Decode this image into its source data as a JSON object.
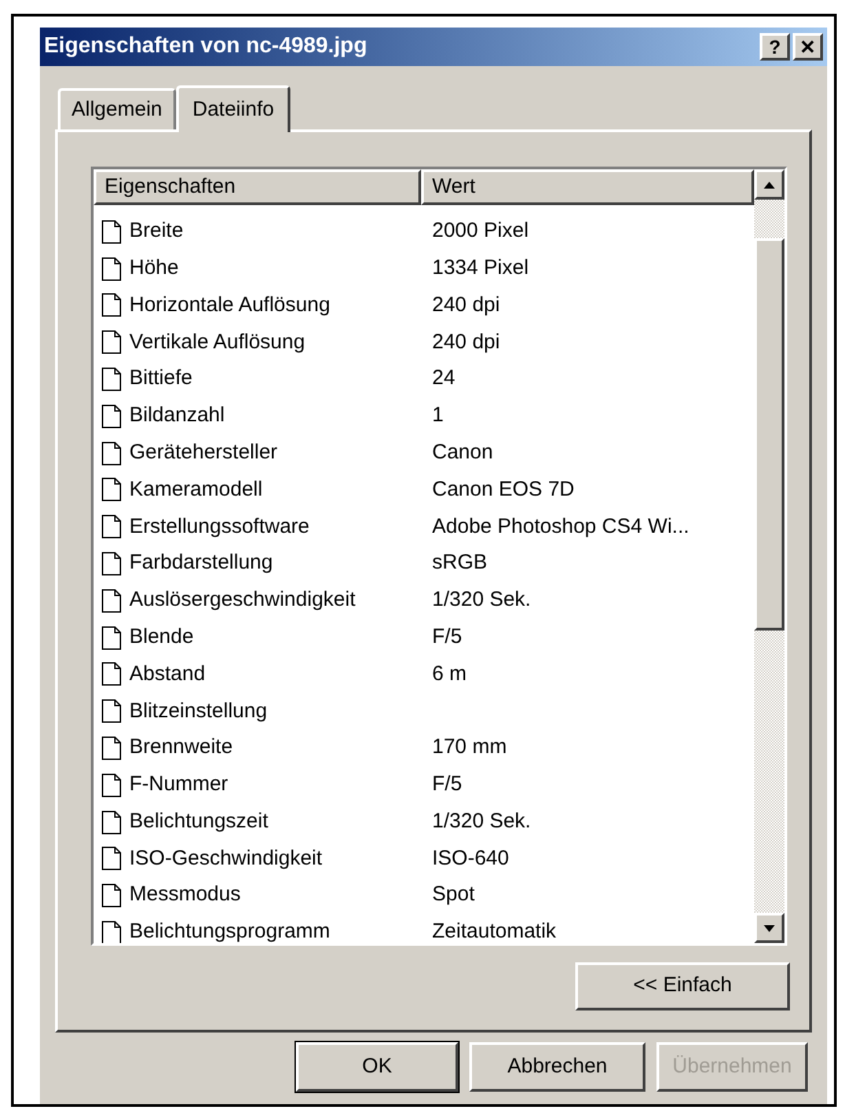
{
  "window": {
    "title": "Eigenschaften von nc-4989.jpg",
    "title_buttons": [
      "?",
      "✕"
    ]
  },
  "tabs": [
    {
      "label": "Allgemein",
      "selected": false
    },
    {
      "label": "Dateiinfo",
      "selected": true
    }
  ],
  "list": {
    "columns": [
      "Eigenschaften",
      "Wert"
    ],
    "rows": [
      {
        "name": "Breite",
        "value": "2000 Pixel"
      },
      {
        "name": "Höhe",
        "value": "1334 Pixel"
      },
      {
        "name": "Horizontale Auflösung",
        "value": "240 dpi"
      },
      {
        "name": "Vertikale Auflösung",
        "value": "240 dpi"
      },
      {
        "name": "Bittiefe",
        "value": "24"
      },
      {
        "name": "Bildanzahl",
        "value": "1"
      },
      {
        "name": "Gerätehersteller",
        "value": "Canon"
      },
      {
        "name": "Kameramodell",
        "value": "Canon EOS 7D"
      },
      {
        "name": "Erstellungssoftware",
        "value": "Adobe Photoshop CS4 Wi..."
      },
      {
        "name": "Farbdarstellung",
        "value": "sRGB"
      },
      {
        "name": "Auslösergeschwindigkeit",
        "value": "1/320 Sek."
      },
      {
        "name": "Blende",
        "value": "F/5"
      },
      {
        "name": "Abstand",
        "value": "6 m"
      },
      {
        "name": "Blitzeinstellung"
      },
      {
        "name": "Brennweite",
        "value": "170 mm"
      },
      {
        "name": "F-Nummer",
        "value": "F/5"
      },
      {
        "name": "Belichtungszeit",
        "value": "1/320 Sek."
      },
      {
        "name": "ISO-Geschwindigkeit",
        "value": "ISO-640"
      },
      {
        "name": "Messmodus",
        "value": "Spot"
      },
      {
        "name": "Belichtungsprogramm",
        "value": "Zeitautomatik"
      }
    ]
  },
  "toggle_button": "<< Einfach",
  "buttons": [
    {
      "label": "OK",
      "disabled": false,
      "default": true
    },
    {
      "label": "Abbrechen",
      "disabled": false,
      "default": false
    },
    {
      "label": "Übernehmen",
      "disabled": true,
      "default": false
    }
  ]
}
